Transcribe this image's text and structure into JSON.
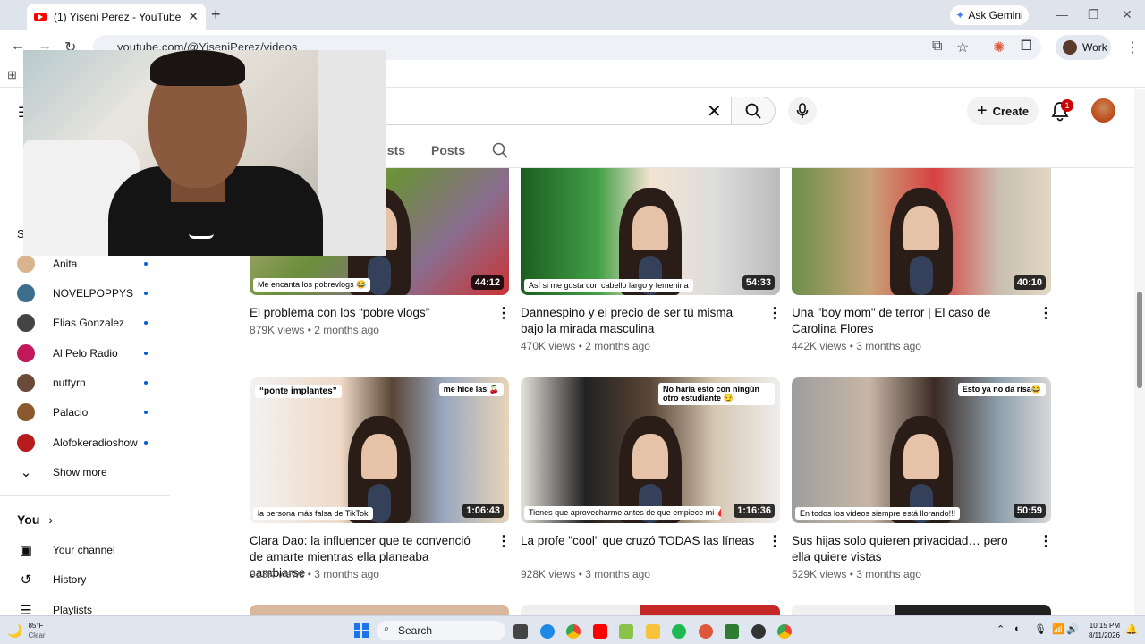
{
  "browser": {
    "tab_title": "(1) Yiseni Perez - YouTube",
    "url": "youtube.com/@YiseniPerez/videos",
    "ask_gemini": "Ask Gemini",
    "profile": "Work"
  },
  "header": {
    "create_label": "Create",
    "notification_count": "1"
  },
  "channel_tabs": {
    "playlists_partial": "lists",
    "posts": "Posts"
  },
  "sidebar": {
    "subscriptions_initial": "S",
    "subscriptions": [
      {
        "name": "Anita",
        "color": "#d9b48f"
      },
      {
        "name": "NOVELPOPPYS",
        "color": "#3b6e8c"
      },
      {
        "name": "Elias Gonzalez",
        "color": "#444444"
      },
      {
        "name": "Al Pelo Radio",
        "color": "#c2185b"
      },
      {
        "name": "nuttyrn",
        "color": "#6b4a3a"
      },
      {
        "name": "Palacio",
        "color": "#8a5a2e"
      },
      {
        "name": "Alofokeradioshow",
        "color": "#b71c1c"
      }
    ],
    "show_more": "Show more",
    "you_label": "You",
    "your_channel": "Your channel",
    "history": "History",
    "playlists": "Playlists"
  },
  "videos": [
    {
      "title": "El problema con los “pobre vlogs”",
      "views": "879K views",
      "age": "2 months ago",
      "duration": "44:12",
      "caption": "Me encanta los pobrevlogs 😂"
    },
    {
      "title": "Dannespino y el precio de ser tú misma bajo la mirada masculina",
      "views": "470K views",
      "age": "2 months ago",
      "duration": "54:33",
      "caption": "Así si me gusta con cabello largo y femenina"
    },
    {
      "title": "Una \"boy mom\" de terror | El caso de Carolina Flores",
      "views": "442K views",
      "age": "3 months ago",
      "duration": "40:10",
      "caption": ""
    },
    {
      "title": "Clara Dao: la influencer que te convenció de amarte mientras ella planeaba cambiarse",
      "views": "913K views",
      "age": "3 months ago",
      "duration": "1:06:43",
      "caption": "la persona más falsa de TikTok",
      "caption_top_left": "“ponte implantes”",
      "caption_top_right": "me hice las 🍒"
    },
    {
      "title": "La profe \"cool\" que cruzó TODAS las líneas",
      "views": "928K views",
      "age": "3 months ago",
      "duration": "1:16:36",
      "caption": "Tienes que aprovecharme antes de que empiece mi 🩸",
      "caption_top_right": "No haría esto con ningún otro estudiante 😏"
    },
    {
      "title": "Sus hijas solo quieren privacidad… pero ella quiere vistas",
      "views": "529K views",
      "age": "3 months ago",
      "duration": "50:59",
      "caption": "En todos los videos siempre está llorando!!!",
      "caption_top_right": "Esto ya no da risa😂"
    }
  ],
  "taskbar": {
    "temperature": "85°F",
    "weather": "Clear",
    "search_label": "Search",
    "time": "10:15 PM",
    "date": "8/11/2026"
  }
}
